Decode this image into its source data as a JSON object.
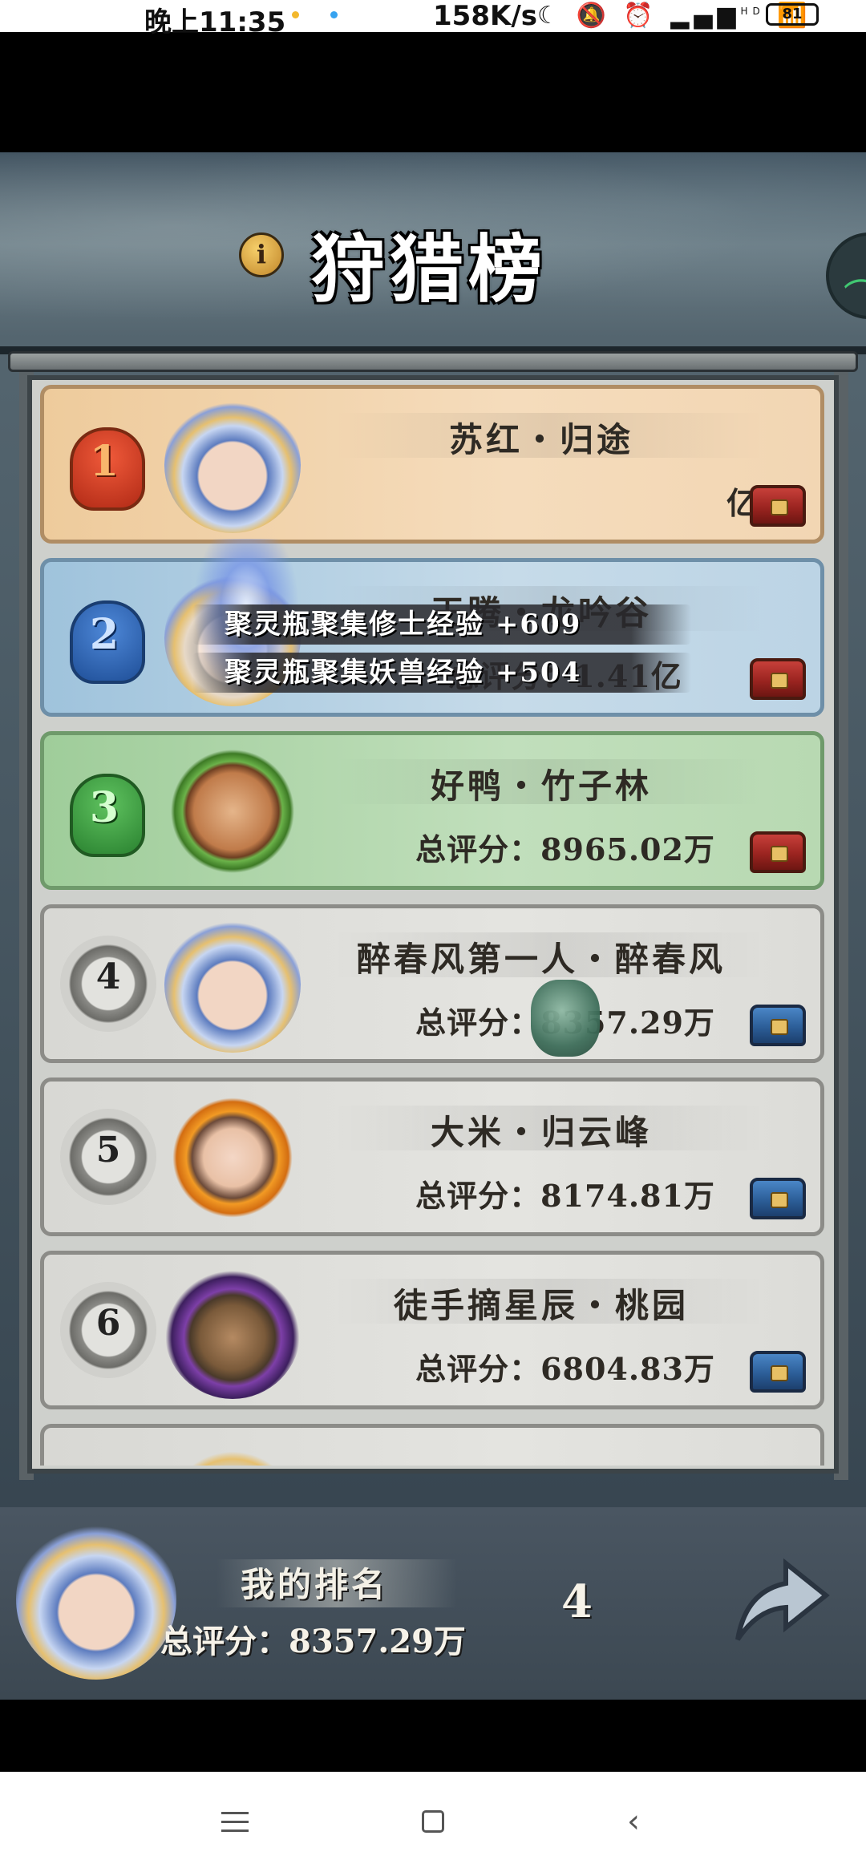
{
  "status_bar": {
    "time": "晚上11:35",
    "net_speed": "158K/s",
    "icons": [
      "moon-icon",
      "mute-icon",
      "alarm-icon",
      "signal-icon",
      "wifi-icon"
    ],
    "signal_label": "HD",
    "battery": "81"
  },
  "header": {
    "title": "狩猎榜",
    "info_icon": "i"
  },
  "toast": {
    "line1": "聚灵瓶聚集修士经验 +609",
    "line2": "聚灵瓶聚集妖兽经验 +504"
  },
  "ranking": [
    {
      "rank": "1",
      "name": "苏红・归途",
      "score": "亿",
      "chest": "red"
    },
    {
      "rank": "2",
      "name": "王腾・龙吟谷",
      "score": "总评分：1.41亿",
      "chest": "red"
    },
    {
      "rank": "3",
      "name": "好鸭・竹子林",
      "score": "总评分：8965.02万",
      "chest": "red"
    },
    {
      "rank": "4",
      "name": "醉春风第一人・醉春风",
      "score": "总评分：8357.29万",
      "chest": "blue"
    },
    {
      "rank": "5",
      "name": "大米・归云峰",
      "score": "总评分：8174.81万",
      "chest": "blue"
    },
    {
      "rank": "6",
      "name": "徒手摘星辰・桃园",
      "score": "总评分：6804.83万",
      "chest": "blue"
    }
  ],
  "my_rank": {
    "label": "我的排名",
    "score": "总评分：8357.29万",
    "rank": "4"
  },
  "colors": {
    "rank1_card": "#f2d6b3",
    "rank2_card": "#bcd4e5",
    "rank3_card": "#b8d9b2",
    "default_card": "#dcdcd8",
    "panel": "#ced0cc"
  }
}
